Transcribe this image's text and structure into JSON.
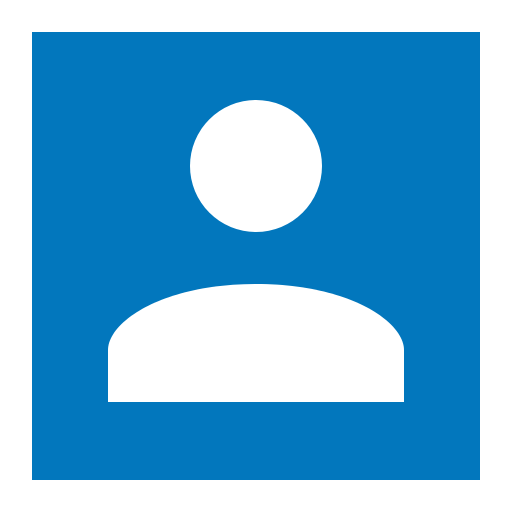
{
  "avatar": {
    "icon": "user-silhouette-icon",
    "background_color": "#0277bd",
    "foreground_color": "#ffffff"
  }
}
